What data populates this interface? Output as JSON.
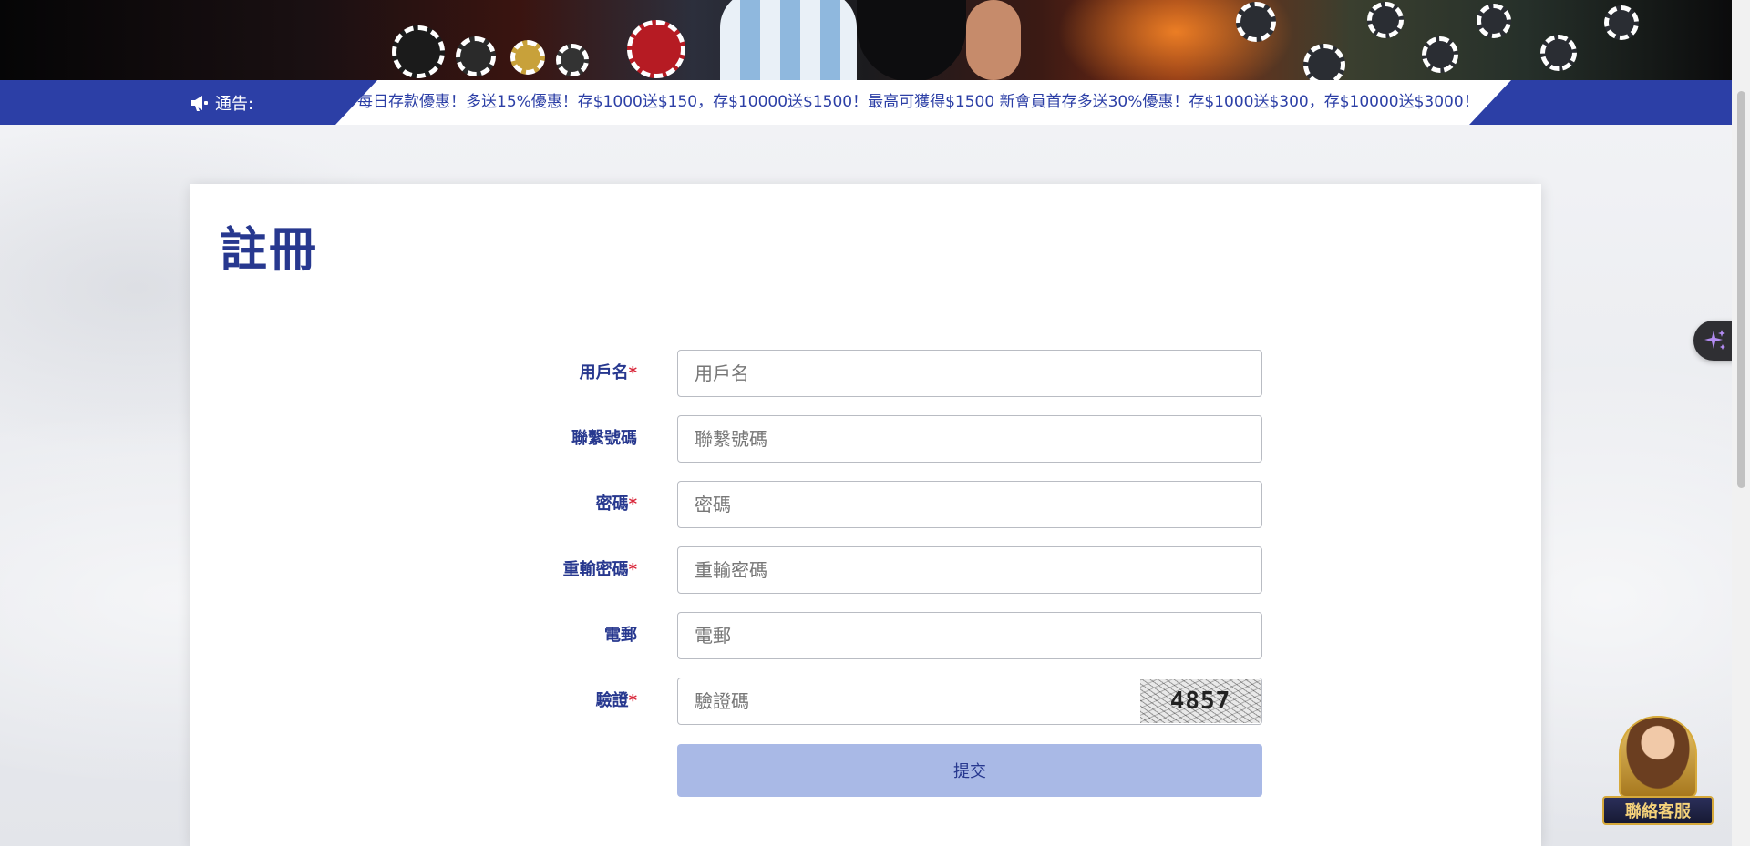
{
  "notice": {
    "label": "通告:",
    "text": "每日存款優惠！多送15%優惠！存$1000送$150，存$10000送$1500！最高可獲得$1500  新會員首存多送30%優惠！存$1000送$300，存$10000送$3000！"
  },
  "page": {
    "title": "註冊"
  },
  "form": {
    "fields": [
      {
        "label": "用戶名",
        "required": "*",
        "placeholder": "用戶名"
      },
      {
        "label": "聯繫號碼",
        "required": "",
        "placeholder": "聯繫號碼"
      },
      {
        "label": "密碼",
        "required": "*",
        "placeholder": "密碼"
      },
      {
        "label": "重輸密碼",
        "required": "*",
        "placeholder": "重輸密碼"
      },
      {
        "label": "電郵",
        "required": "",
        "placeholder": "電郵"
      },
      {
        "label": "驗證",
        "required": "*",
        "placeholder": "驗證碼"
      }
    ],
    "captcha_text": "4857",
    "submit_label": "提交"
  },
  "widgets": {
    "customer_service_label": "聯絡客服",
    "ai_icon": "sparkle-icon"
  },
  "colors": {
    "brand_blue": "#2c3fa6",
    "title_blue": "#27388f",
    "required_red": "#d9273a",
    "submit_bg": "#a9b9e6"
  }
}
